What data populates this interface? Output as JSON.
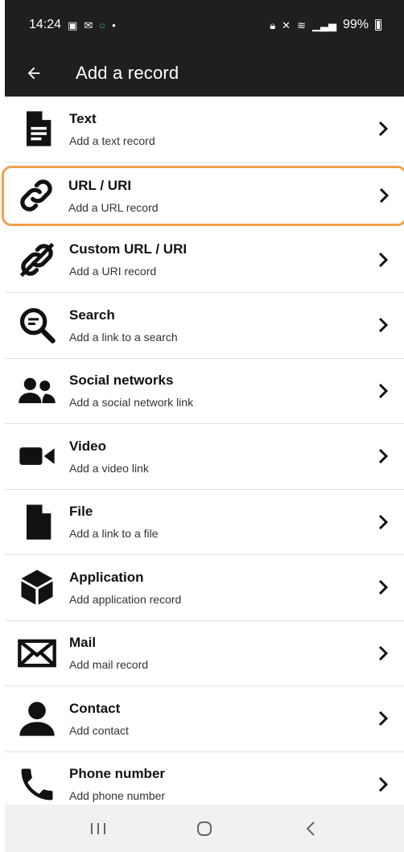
{
  "status": {
    "time": "14:24",
    "battery": "99%",
    "icons_left": [
      "image-icon",
      "chat-icon",
      "circle-icon",
      "dot-icon"
    ],
    "icons_right": [
      "lock-icon",
      "mute-icon",
      "wifi-icon",
      "signal-icon",
      "battery-icon"
    ]
  },
  "app_bar": {
    "title": "Add a record",
    "back_icon": "arrow-left-icon"
  },
  "records": [
    {
      "title": "Text",
      "subtitle": "Add a text record",
      "icon": "document-lines-icon"
    },
    {
      "title": "URL / URI",
      "subtitle": "Add a URL record",
      "icon": "link-icon",
      "highlighted": true
    },
    {
      "title": "Custom URL / URI",
      "subtitle": "Add a URI record",
      "icon": "broken-link-icon"
    },
    {
      "title": "Search",
      "subtitle": "Add a link to a search",
      "icon": "search-icon"
    },
    {
      "title": "Social networks",
      "subtitle": "Add a social network link",
      "icon": "people-icon"
    },
    {
      "title": "Video",
      "subtitle": "Add a video link",
      "icon": "video-camera-icon"
    },
    {
      "title": "File",
      "subtitle": "Add a link to a file",
      "icon": "file-icon"
    },
    {
      "title": "Application",
      "subtitle": "Add application record",
      "icon": "cube-icon"
    },
    {
      "title": "Mail",
      "subtitle": "Add mail record",
      "icon": "envelope-icon"
    },
    {
      "title": "Contact",
      "subtitle": "Add contact",
      "icon": "person-icon"
    },
    {
      "title": "Phone number",
      "subtitle": "Add phone number",
      "icon": "phone-icon"
    }
  ],
  "nav": {
    "recents_icon": "recents-icon",
    "home_icon": "home-icon",
    "back_icon": "back-chevron-icon"
  },
  "colors": {
    "app_bar": "#1f1f1f",
    "highlight": "#f0a04b",
    "divider": "#e2e2e2",
    "nav_bar": "#f1f1f1"
  }
}
